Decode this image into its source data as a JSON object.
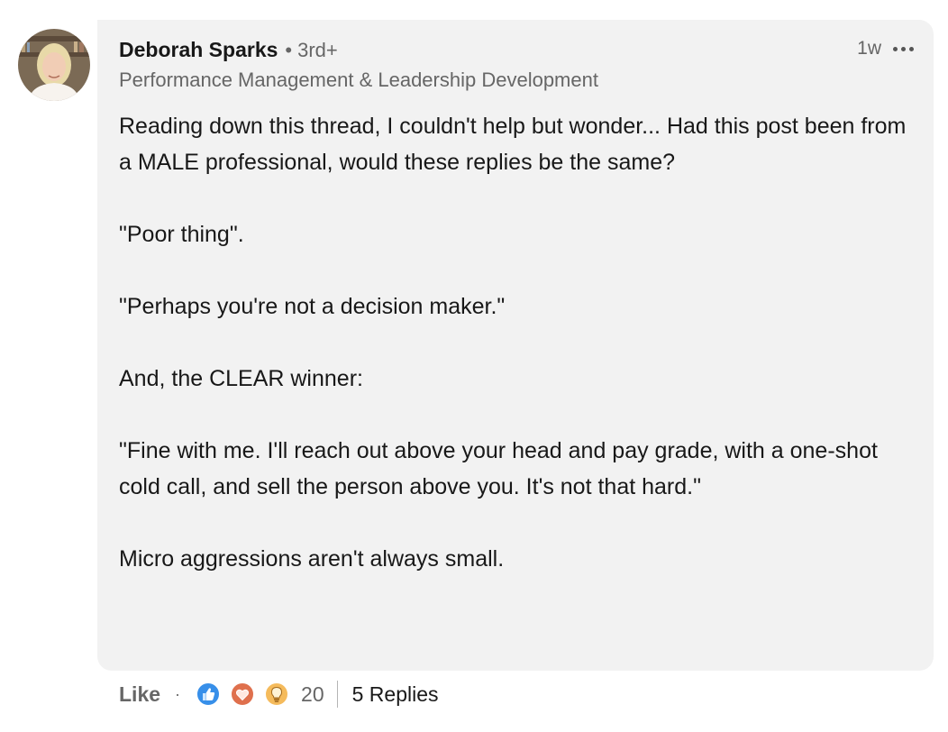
{
  "comment": {
    "author_name": "Deborah Sparks",
    "degree_separator": "•",
    "degree": "3rd+",
    "headline": "Performance Management & Leadership Development",
    "timestamp": "1w",
    "avatar_icon": "profile-photo",
    "more_icon": "ellipsis-icon",
    "paragraphs": [
      "Reading down this thread, I couldn't help but wonder... Had this post been from a MALE professional, would these replies be the same?",
      "\"Poor thing\".",
      "\"Perhaps you're not a decision maker.\"",
      "And, the CLEAR winner:",
      "\"Fine with me. I'll reach out above your head and pay grade, with a one-shot cold call, and sell the person above you. It's not that hard.\"",
      "Micro aggressions aren't always small."
    ]
  },
  "actions": {
    "like_label": "Like",
    "separator": "·",
    "reaction_icons": [
      "like-reaction-icon",
      "love-reaction-icon",
      "insightful-reaction-icon"
    ],
    "reaction_count": "20",
    "replies_label": "5 Replies"
  },
  "colors": {
    "bubble_bg": "#f2f2f2",
    "secondary_text": "#666666",
    "like_blue": "#378fe9",
    "love_red": "#df704d",
    "insightful_yellow": "#f5bb5c"
  }
}
